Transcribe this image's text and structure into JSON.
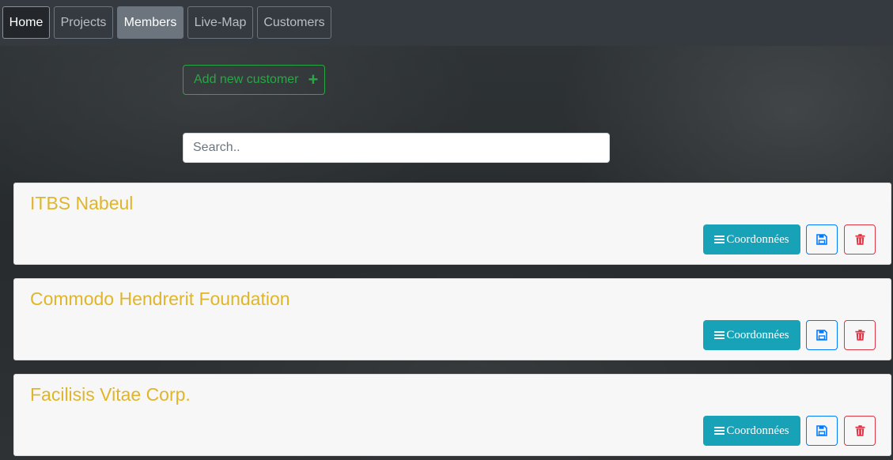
{
  "nav": {
    "items": [
      {
        "label": "Home",
        "state": "home"
      },
      {
        "label": "Projects",
        "state": "normal"
      },
      {
        "label": "Members",
        "state": "active"
      },
      {
        "label": "Live-Map",
        "state": "normal"
      },
      {
        "label": "Customers",
        "state": "normal"
      }
    ]
  },
  "actions": {
    "add_label": "Add new customer",
    "add_icon": "plus-icon"
  },
  "search": {
    "placeholder": "Search..",
    "value": ""
  },
  "customers": [
    {
      "name": "ITBS Nabeul",
      "details_label": "Coordonnées"
    },
    {
      "name": "Commodo Hendrerit Foundation",
      "details_label": "Coordonnées"
    },
    {
      "name": "Facilisis Vitae Corp.",
      "details_label": "Coordonnées"
    }
  ],
  "colors": {
    "navbar": "#343a40",
    "success": "#28a745",
    "info": "#17a2b8",
    "primary": "#007bff",
    "danger": "#dc3545",
    "title": "#e0b52a",
    "card": "#f7f7f7"
  }
}
